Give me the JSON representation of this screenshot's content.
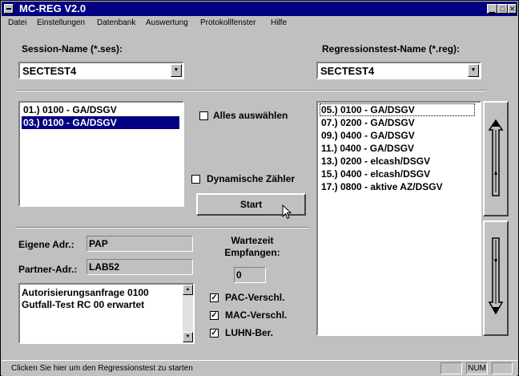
{
  "window": {
    "title": "MC-REG V2.0"
  },
  "menu": [
    "Datei",
    "Einstellungen",
    "Datenbank",
    "Auswertung",
    "Protokollfenster",
    "Hilfe"
  ],
  "session": {
    "label": "Session-Name (*.ses):",
    "value": "SECTEST4"
  },
  "regtest": {
    "label": "Regressionstest-Name (*.reg):",
    "value": "SECTEST4"
  },
  "left_list": {
    "items": [
      "01.) 0100 - GA/DSGV",
      "03.) 0100 - GA/DSGV"
    ],
    "selected_index": 1
  },
  "select_all": {
    "label": "Alles auswählen",
    "checked": false
  },
  "dyn_counter": {
    "label": "Dynamische Zähler",
    "checked": false
  },
  "start_button": "Start",
  "right_list": {
    "items": [
      "05.) 0100 - GA/DSGV",
      "07.) 0200 - GA/DSGV",
      "09.) 0400 - GA/DSGV",
      "11.) 0400 - GA/DSGV",
      "13.) 0200 - elcash/DSGV",
      "15.) 0400 - elcash/DSGV",
      "17.) 0800 - aktive AZ/DSGV"
    ],
    "focused_index": 0
  },
  "own_addr": {
    "label": "Eigene Adr.:",
    "value": "PAP"
  },
  "partner_addr": {
    "label": "Partner-Adr.:",
    "value": "LAB52"
  },
  "wait": {
    "label_line1": "Wartezeit",
    "label_line2": "Empfangen:",
    "value": "0"
  },
  "message": {
    "line1": "Autorisierungsanfrage 0100",
    "line2": "Gutfall-Test RC 00 erwartet"
  },
  "pac": {
    "label": "PAC-Verschl.",
    "checked": true
  },
  "mac": {
    "label": "MAC-Verschl.",
    "checked": true
  },
  "luhn": {
    "label": "LUHN-Ber.",
    "checked": true
  },
  "status": {
    "text": "Clicken Sie hier um den Regressionstest zu starten",
    "num": "NUM"
  }
}
